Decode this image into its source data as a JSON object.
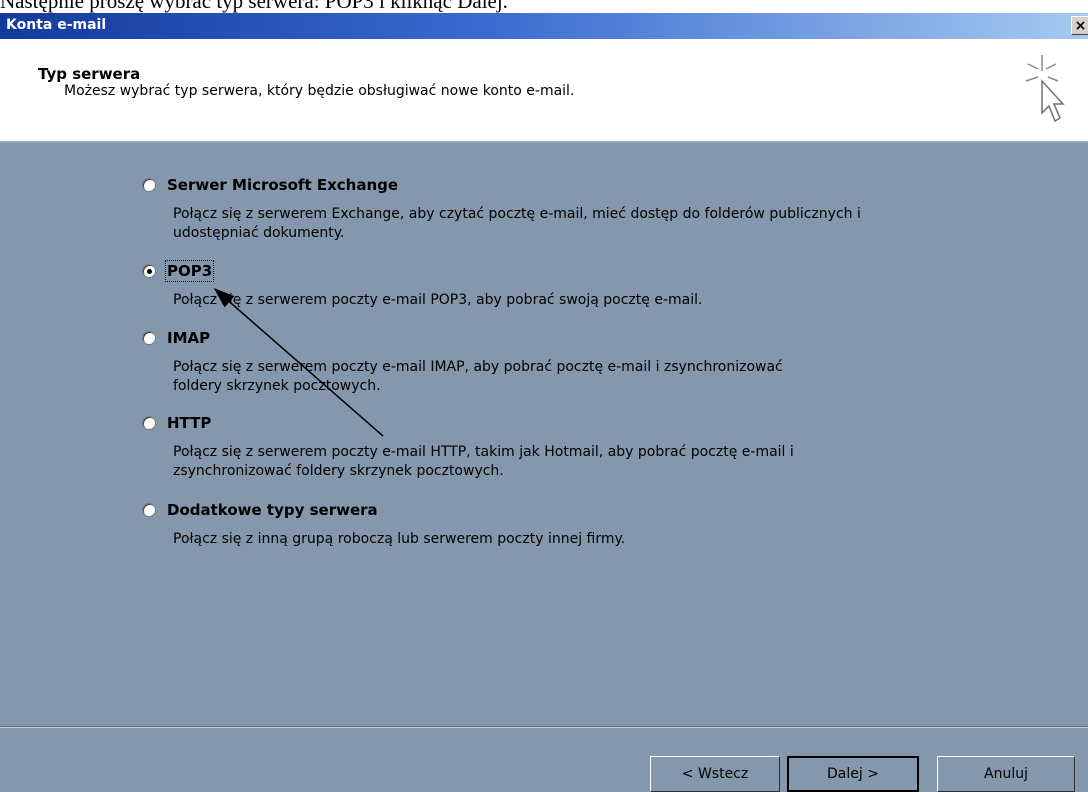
{
  "document_line": "Następnie proszę wybrać typ serwera: POP3 i kliknąć Dalej.",
  "window": {
    "title": "Konta e-mail",
    "close_label": "×"
  },
  "header": {
    "title": "Typ serwera",
    "subtitle": "Możesz wybrać typ serwera, który będzie obsługiwać nowe konto e-mail."
  },
  "options": [
    {
      "label": "Serwer Microsoft Exchange",
      "description": "Połącz się z serwerem Exchange, aby czytać pocztę e-mail, mieć dostęp do folderów publicznych i udostępniać dokumenty.",
      "checked": false
    },
    {
      "label": "POP3",
      "description": "Połącz się z serwerem poczty e-mail POP3, aby pobrać swoją pocztę e-mail.",
      "checked": true
    },
    {
      "label": "IMAP",
      "description": "Połącz się z serwerem poczty e-mail IMAP, aby pobrać pocztę e-mail i zsynchronizować foldery skrzynek pocztowych.",
      "checked": false
    },
    {
      "label": "HTTP",
      "description": "Połącz się z serwerem poczty e-mail HTTP, takim jak Hotmail, aby pobrać pocztę e-mail i zsynchronizować foldery skrzynek pocztowych.",
      "checked": false
    },
    {
      "label": "Dodatkowe typy serwera",
      "description": "Połącz się z inną grupą roboczą lub serwerem poczty innej firmy.",
      "checked": false
    }
  ],
  "buttons": {
    "back": "< Wstecz",
    "next": "Dalej >",
    "cancel": "Anuluj"
  },
  "colors": {
    "dialog_bg": "#8497ad",
    "titlebar_start": "#14399c",
    "titlebar_end": "#a6caf0"
  },
  "icons": {
    "wizard": "cursor-sparkle-icon",
    "close": "close-icon",
    "annotation": "arrow-pointer"
  }
}
